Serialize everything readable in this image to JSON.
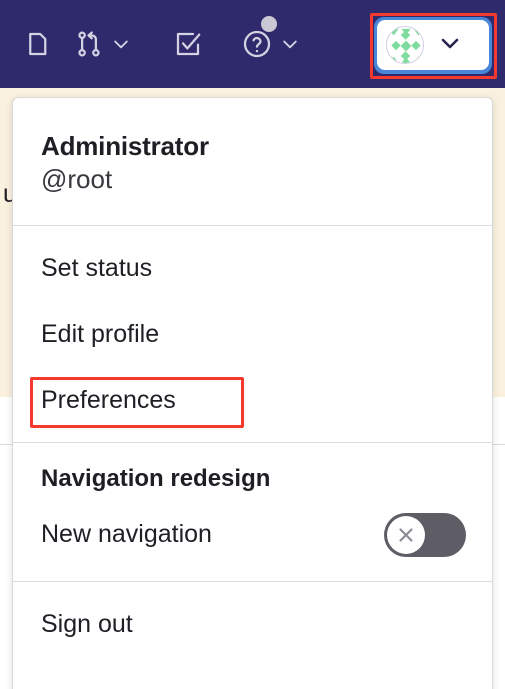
{
  "topbar": {
    "background_color": "#2f2a6b",
    "items": [
      {
        "id": "issues",
        "icon": "issues-icon",
        "label": "Issues",
        "has_chevron": false
      },
      {
        "id": "merge-requests",
        "icon": "merge-request-icon",
        "label": "Merge requests",
        "has_chevron": true
      },
      {
        "id": "todos",
        "icon": "todo-checkbox-icon",
        "label": "To-Do List",
        "has_chevron": false
      },
      {
        "id": "help",
        "icon": "help-circle-icon",
        "label": "Help",
        "has_chevron": true,
        "has_notification_dot": true
      }
    ],
    "user_menu_button": {
      "label": "User menu",
      "avatar_icon": "user-avatar-identicon",
      "chevron_icon": "chevron-down-icon",
      "focused": true,
      "focus_ring_color": "#4a86d8"
    }
  },
  "page_behind": {
    "banner_color": "#faf1de",
    "partial_text": "u"
  },
  "annotations": {
    "color": "#f5392e",
    "boxes": [
      {
        "target": "user-menu-button"
      },
      {
        "target": "preferences-menu-item"
      }
    ]
  },
  "dropdown": {
    "user": {
      "name": "Administrator",
      "handle": "@root"
    },
    "items": [
      {
        "id": "set-status",
        "label": "Set status"
      },
      {
        "id": "edit-profile",
        "label": "Edit profile"
      },
      {
        "id": "preferences",
        "label": "Preferences",
        "highlighted": true
      }
    ],
    "navigation_section": {
      "heading": "Navigation redesign",
      "toggle": {
        "label": "New navigation",
        "state": "off",
        "track_color": "#5e5c65",
        "knob_icon": "close-x-icon"
      }
    },
    "sign_out": {
      "id": "sign-out",
      "label": "Sign out"
    }
  }
}
